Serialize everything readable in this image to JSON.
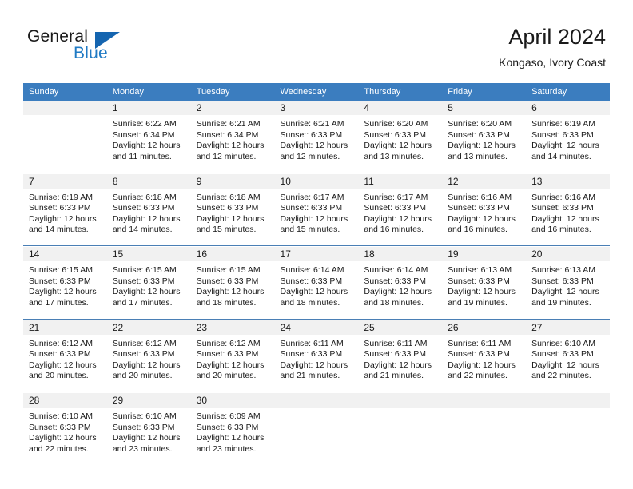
{
  "brand": {
    "name_top": "General",
    "name_bottom": "Blue",
    "triangle_color": "#1565b0",
    "blue_color": "#1f7ac4"
  },
  "header": {
    "title": "April 2024",
    "subtitle": "Kongaso, Ivory Coast"
  },
  "theme": {
    "header_row_bg": "#3b7dbf",
    "daynum_band_bg": "#f1f1f1",
    "week_separator": "#4a7fb5",
    "text": "#1a1a1a"
  },
  "weekdays": [
    "Sunday",
    "Monday",
    "Tuesday",
    "Wednesday",
    "Thursday",
    "Friday",
    "Saturday"
  ],
  "weeks": [
    [
      {
        "day": "",
        "sunrise": "",
        "sunset": "",
        "daylight1": "",
        "daylight2": ""
      },
      {
        "day": "1",
        "sunrise": "Sunrise: 6:22 AM",
        "sunset": "Sunset: 6:34 PM",
        "daylight1": "Daylight: 12 hours",
        "daylight2": "and 11 minutes."
      },
      {
        "day": "2",
        "sunrise": "Sunrise: 6:21 AM",
        "sunset": "Sunset: 6:34 PM",
        "daylight1": "Daylight: 12 hours",
        "daylight2": "and 12 minutes."
      },
      {
        "day": "3",
        "sunrise": "Sunrise: 6:21 AM",
        "sunset": "Sunset: 6:33 PM",
        "daylight1": "Daylight: 12 hours",
        "daylight2": "and 12 minutes."
      },
      {
        "day": "4",
        "sunrise": "Sunrise: 6:20 AM",
        "sunset": "Sunset: 6:33 PM",
        "daylight1": "Daylight: 12 hours",
        "daylight2": "and 13 minutes."
      },
      {
        "day": "5",
        "sunrise": "Sunrise: 6:20 AM",
        "sunset": "Sunset: 6:33 PM",
        "daylight1": "Daylight: 12 hours",
        "daylight2": "and 13 minutes."
      },
      {
        "day": "6",
        "sunrise": "Sunrise: 6:19 AM",
        "sunset": "Sunset: 6:33 PM",
        "daylight1": "Daylight: 12 hours",
        "daylight2": "and 14 minutes."
      }
    ],
    [
      {
        "day": "7",
        "sunrise": "Sunrise: 6:19 AM",
        "sunset": "Sunset: 6:33 PM",
        "daylight1": "Daylight: 12 hours",
        "daylight2": "and 14 minutes."
      },
      {
        "day": "8",
        "sunrise": "Sunrise: 6:18 AM",
        "sunset": "Sunset: 6:33 PM",
        "daylight1": "Daylight: 12 hours",
        "daylight2": "and 14 minutes."
      },
      {
        "day": "9",
        "sunrise": "Sunrise: 6:18 AM",
        "sunset": "Sunset: 6:33 PM",
        "daylight1": "Daylight: 12 hours",
        "daylight2": "and 15 minutes."
      },
      {
        "day": "10",
        "sunrise": "Sunrise: 6:17 AM",
        "sunset": "Sunset: 6:33 PM",
        "daylight1": "Daylight: 12 hours",
        "daylight2": "and 15 minutes."
      },
      {
        "day": "11",
        "sunrise": "Sunrise: 6:17 AM",
        "sunset": "Sunset: 6:33 PM",
        "daylight1": "Daylight: 12 hours",
        "daylight2": "and 16 minutes."
      },
      {
        "day": "12",
        "sunrise": "Sunrise: 6:16 AM",
        "sunset": "Sunset: 6:33 PM",
        "daylight1": "Daylight: 12 hours",
        "daylight2": "and 16 minutes."
      },
      {
        "day": "13",
        "sunrise": "Sunrise: 6:16 AM",
        "sunset": "Sunset: 6:33 PM",
        "daylight1": "Daylight: 12 hours",
        "daylight2": "and 16 minutes."
      }
    ],
    [
      {
        "day": "14",
        "sunrise": "Sunrise: 6:15 AM",
        "sunset": "Sunset: 6:33 PM",
        "daylight1": "Daylight: 12 hours",
        "daylight2": "and 17 minutes."
      },
      {
        "day": "15",
        "sunrise": "Sunrise: 6:15 AM",
        "sunset": "Sunset: 6:33 PM",
        "daylight1": "Daylight: 12 hours",
        "daylight2": "and 17 minutes."
      },
      {
        "day": "16",
        "sunrise": "Sunrise: 6:15 AM",
        "sunset": "Sunset: 6:33 PM",
        "daylight1": "Daylight: 12 hours",
        "daylight2": "and 18 minutes."
      },
      {
        "day": "17",
        "sunrise": "Sunrise: 6:14 AM",
        "sunset": "Sunset: 6:33 PM",
        "daylight1": "Daylight: 12 hours",
        "daylight2": "and 18 minutes."
      },
      {
        "day": "18",
        "sunrise": "Sunrise: 6:14 AM",
        "sunset": "Sunset: 6:33 PM",
        "daylight1": "Daylight: 12 hours",
        "daylight2": "and 18 minutes."
      },
      {
        "day": "19",
        "sunrise": "Sunrise: 6:13 AM",
        "sunset": "Sunset: 6:33 PM",
        "daylight1": "Daylight: 12 hours",
        "daylight2": "and 19 minutes."
      },
      {
        "day": "20",
        "sunrise": "Sunrise: 6:13 AM",
        "sunset": "Sunset: 6:33 PM",
        "daylight1": "Daylight: 12 hours",
        "daylight2": "and 19 minutes."
      }
    ],
    [
      {
        "day": "21",
        "sunrise": "Sunrise: 6:12 AM",
        "sunset": "Sunset: 6:33 PM",
        "daylight1": "Daylight: 12 hours",
        "daylight2": "and 20 minutes."
      },
      {
        "day": "22",
        "sunrise": "Sunrise: 6:12 AM",
        "sunset": "Sunset: 6:33 PM",
        "daylight1": "Daylight: 12 hours",
        "daylight2": "and 20 minutes."
      },
      {
        "day": "23",
        "sunrise": "Sunrise: 6:12 AM",
        "sunset": "Sunset: 6:33 PM",
        "daylight1": "Daylight: 12 hours",
        "daylight2": "and 20 minutes."
      },
      {
        "day": "24",
        "sunrise": "Sunrise: 6:11 AM",
        "sunset": "Sunset: 6:33 PM",
        "daylight1": "Daylight: 12 hours",
        "daylight2": "and 21 minutes."
      },
      {
        "day": "25",
        "sunrise": "Sunrise: 6:11 AM",
        "sunset": "Sunset: 6:33 PM",
        "daylight1": "Daylight: 12 hours",
        "daylight2": "and 21 minutes."
      },
      {
        "day": "26",
        "sunrise": "Sunrise: 6:11 AM",
        "sunset": "Sunset: 6:33 PM",
        "daylight1": "Daylight: 12 hours",
        "daylight2": "and 22 minutes."
      },
      {
        "day": "27",
        "sunrise": "Sunrise: 6:10 AM",
        "sunset": "Sunset: 6:33 PM",
        "daylight1": "Daylight: 12 hours",
        "daylight2": "and 22 minutes."
      }
    ],
    [
      {
        "day": "28",
        "sunrise": "Sunrise: 6:10 AM",
        "sunset": "Sunset: 6:33 PM",
        "daylight1": "Daylight: 12 hours",
        "daylight2": "and 22 minutes."
      },
      {
        "day": "29",
        "sunrise": "Sunrise: 6:10 AM",
        "sunset": "Sunset: 6:33 PM",
        "daylight1": "Daylight: 12 hours",
        "daylight2": "and 23 minutes."
      },
      {
        "day": "30",
        "sunrise": "Sunrise: 6:09 AM",
        "sunset": "Sunset: 6:33 PM",
        "daylight1": "Daylight: 12 hours",
        "daylight2": "and 23 minutes."
      },
      {
        "day": "",
        "sunrise": "",
        "sunset": "",
        "daylight1": "",
        "daylight2": ""
      },
      {
        "day": "",
        "sunrise": "",
        "sunset": "",
        "daylight1": "",
        "daylight2": ""
      },
      {
        "day": "",
        "sunrise": "",
        "sunset": "",
        "daylight1": "",
        "daylight2": ""
      },
      {
        "day": "",
        "sunrise": "",
        "sunset": "",
        "daylight1": "",
        "daylight2": ""
      }
    ]
  ]
}
